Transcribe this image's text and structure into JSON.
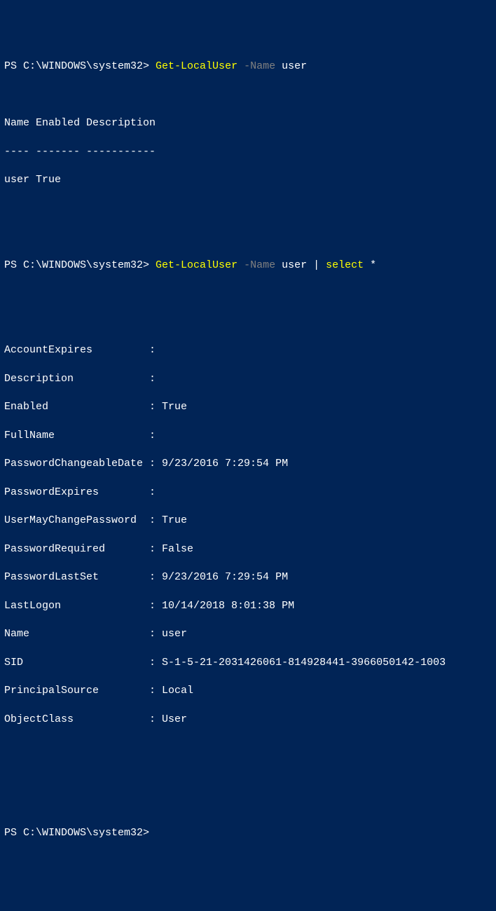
{
  "cmd1": {
    "prompt": "PS C:\\WINDOWS\\system32> ",
    "cmdlet": "Get-LocalUser",
    "param": " -Name ",
    "arg": "user"
  },
  "table1": {
    "header": "Name Enabled Description",
    "divider": "---- ------- -----------",
    "row": "user True"
  },
  "cmd2": {
    "prompt": "PS C:\\WINDOWS\\system32> ",
    "cmdlet": "Get-LocalUser",
    "param": " -Name ",
    "arg": "user",
    "pipe": " | ",
    "cmdlet2": "select",
    "star": " *"
  },
  "props": {
    "l01": "AccountExpires         :",
    "l02": "Description            :",
    "l03": "Enabled                : True",
    "l04": "FullName               :",
    "l05": "PasswordChangeableDate : 9/23/2016 7:29:54 PM",
    "l06": "PasswordExpires        :",
    "l07": "UserMayChangePassword  : True",
    "l08": "PasswordRequired       : False",
    "l09": "PasswordLastSet        : 9/23/2016 7:29:54 PM",
    "l10": "LastLogon              : 10/14/2018 8:01:38 PM",
    "l11": "Name                   : user",
    "l12": "SID                    : S-1-5-21-2031426061-814928441-3966050142-1003",
    "l13": "PrincipalSource        : Local",
    "l14": "ObjectClass            : User"
  },
  "cmd3": {
    "prompt": "PS C:\\WINDOWS\\system32>"
  }
}
